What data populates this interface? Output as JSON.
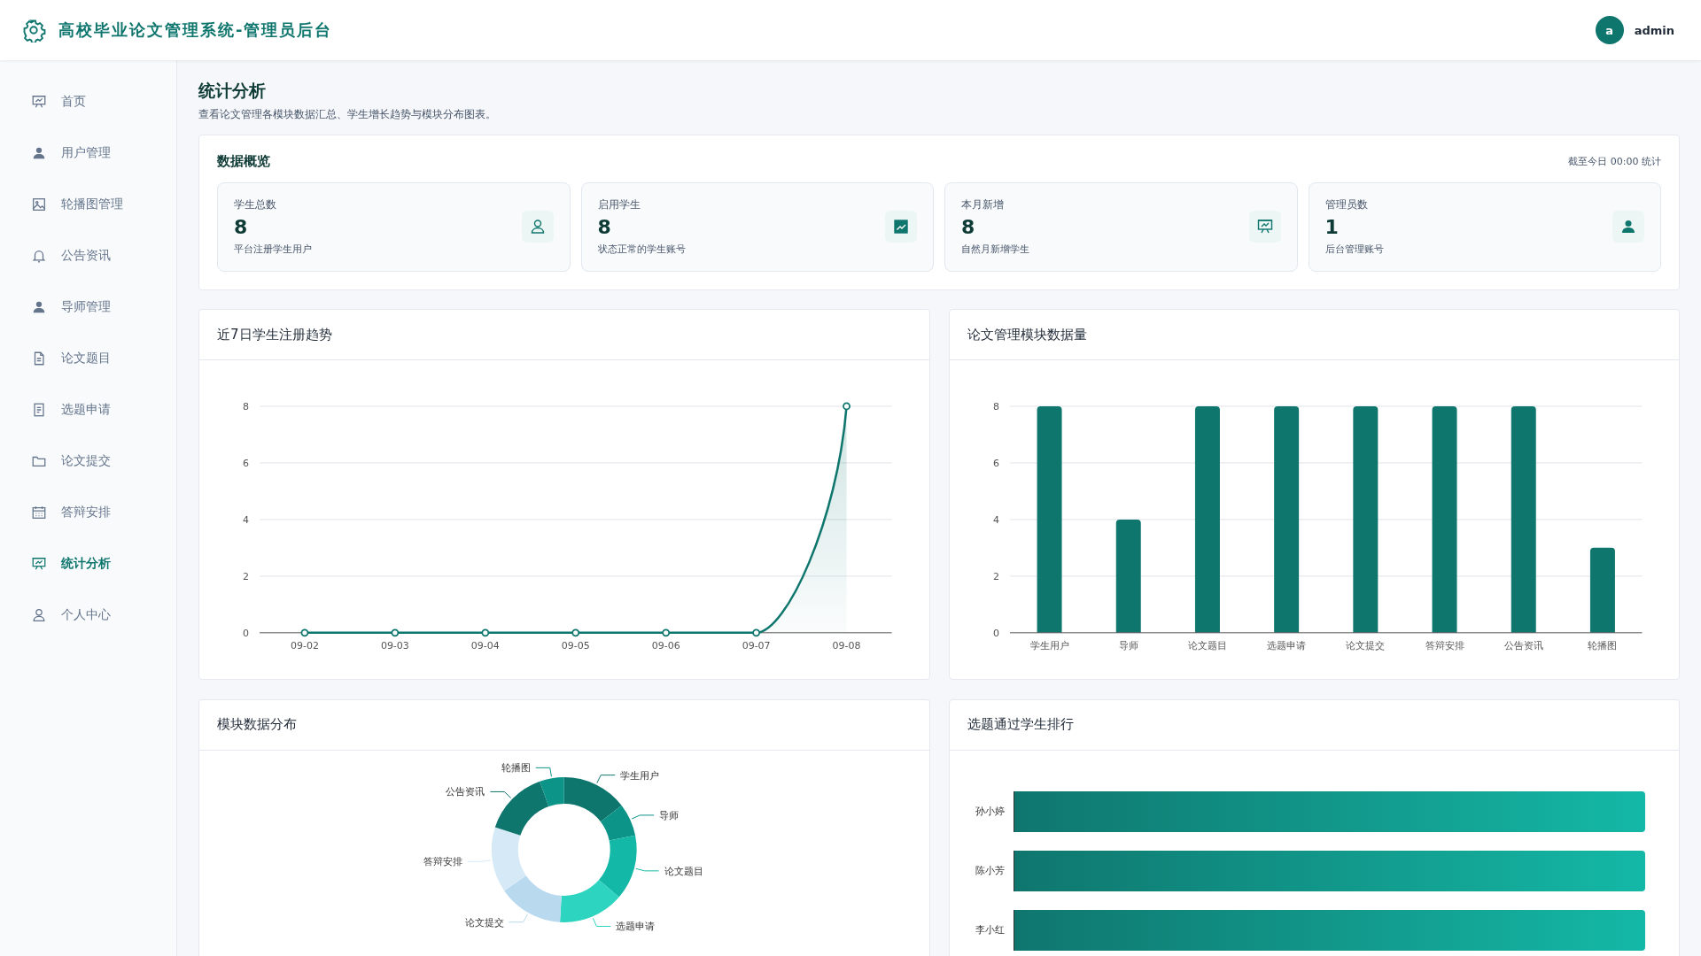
{
  "header": {
    "title": "高校毕业论文管理系统-管理员后台",
    "avatar_letter": "a",
    "username": "admin"
  },
  "sidebar": {
    "items": [
      {
        "label": "首页",
        "kind": "board",
        "selected": false
      },
      {
        "label": "用户管理",
        "kind": "user-solid",
        "selected": false
      },
      {
        "label": "轮播图管理",
        "kind": "image",
        "selected": false
      },
      {
        "label": "公告资讯",
        "kind": "bell",
        "selected": false
      },
      {
        "label": "导师管理",
        "kind": "user-solid",
        "selected": false
      },
      {
        "label": "论文题目",
        "kind": "file",
        "selected": false
      },
      {
        "label": "选题申请",
        "kind": "list",
        "selected": false
      },
      {
        "label": "论文提交",
        "kind": "folder",
        "selected": false
      },
      {
        "label": "答辩安排",
        "kind": "calendar",
        "selected": false
      },
      {
        "label": "统计分析",
        "kind": "board",
        "selected": true
      },
      {
        "label": "个人中心",
        "kind": "user-outline",
        "selected": false
      }
    ]
  },
  "page": {
    "title": "统计分析",
    "subtitle": "查看论文管理各模块数据汇总、学生增长趋势与模块分布图表。"
  },
  "overview": {
    "title": "数据概览",
    "note": "截至今日 00:00 统计",
    "cards": [
      {
        "label": "学生总数",
        "value": "8",
        "desc": "平台注册学生用户",
        "kind": "user-outline"
      },
      {
        "label": "启用学生",
        "value": "8",
        "desc": "状态正常的学生账号",
        "kind": "trend"
      },
      {
        "label": "本月新增",
        "value": "8",
        "desc": "自然月新增学生",
        "kind": "board"
      },
      {
        "label": "管理员数",
        "value": "1",
        "desc": "后台管理账号",
        "kind": "user-solid"
      }
    ]
  },
  "trend_panel": {
    "title": "近7日学生注册趋势",
    "chart_data": {
      "type": "area",
      "categories": [
        "09-02",
        "09-03",
        "09-04",
        "09-05",
        "09-06",
        "09-07",
        "09-08"
      ],
      "series": [
        {
          "color": "#0f766e",
          "values": [
            0,
            0,
            0,
            0,
            0,
            0,
            8
          ]
        }
      ],
      "ylim": [
        0,
        8
      ],
      "yticks": [
        0,
        2,
        4,
        6,
        8
      ],
      "grid": true
    }
  },
  "module_panel": {
    "title": "论文管理模块数据量",
    "chart_data": {
      "type": "bar",
      "categories": [
        "学生用户",
        "导师",
        "论文题目",
        "选题申请",
        "论文提交",
        "答辩安排",
        "公告资讯",
        "轮播图"
      ],
      "series": [
        {
          "color": "#0f766e",
          "values": [
            8,
            4,
            8,
            8,
            8,
            8,
            8,
            3
          ]
        }
      ],
      "ylim": [
        0,
        8
      ],
      "yticks": [
        0,
        2,
        4,
        6,
        8
      ],
      "grid": true
    }
  },
  "distribution_panel": {
    "title": "模块数据分布",
    "chart_data": {
      "type": "donut",
      "categories": [
        "学生用户",
        "导师",
        "论文题目",
        "选题申请",
        "论文提交",
        "答辩安排",
        "公告资讯",
        "轮播图"
      ],
      "series": [
        {
          "values": [
            14.55,
            7.27,
            14.55,
            14.54,
            14.55,
            14.54,
            14.55,
            5.45
          ]
        }
      ],
      "colors": [
        "#0f766e",
        "#0d9488",
        "#14b8a6",
        "#2dd4bf",
        "#b9d9ef",
        "#d6e9f6",
        "#0f766e",
        "#0d9488"
      ]
    }
  },
  "ranking_panel": {
    "title": "选题通过学生排行",
    "rows": [
      {
        "name": "孙小婷"
      },
      {
        "name": "陈小芳"
      },
      {
        "name": "李小红"
      }
    ]
  }
}
